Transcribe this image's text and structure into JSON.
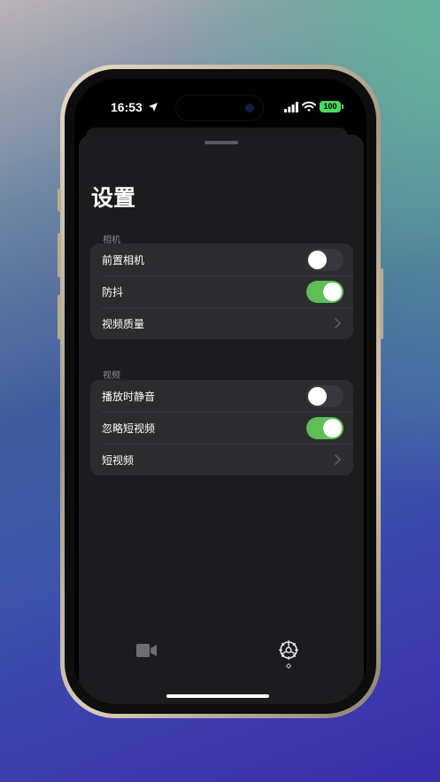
{
  "status_bar": {
    "time": "16:53",
    "battery": "100"
  },
  "settings": {
    "title": "设置",
    "sections": [
      {
        "header": "相机",
        "rows": [
          {
            "label": "前置相机",
            "type": "toggle",
            "on": false
          },
          {
            "label": "防抖",
            "type": "toggle",
            "on": true
          },
          {
            "label": "视频质量",
            "type": "chevron"
          }
        ]
      },
      {
        "header": "视频",
        "rows": [
          {
            "label": "播放时静音",
            "type": "toggle",
            "on": false
          },
          {
            "label": "忽略短视频",
            "type": "toggle",
            "on": true
          },
          {
            "label": "短视频",
            "type": "chevron"
          }
        ]
      }
    ]
  },
  "tabbar": {
    "tabs": [
      {
        "icon": "video-camera-icon",
        "selected": false
      },
      {
        "icon": "gear-icon",
        "selected": true
      }
    ]
  },
  "colors": {
    "toggle_on": "#5ebf57",
    "toggle_off": "#39393d",
    "battery": "#4cd964",
    "sheet_bg": "#1c1c1e",
    "group_bg": "#2c2c2e"
  }
}
